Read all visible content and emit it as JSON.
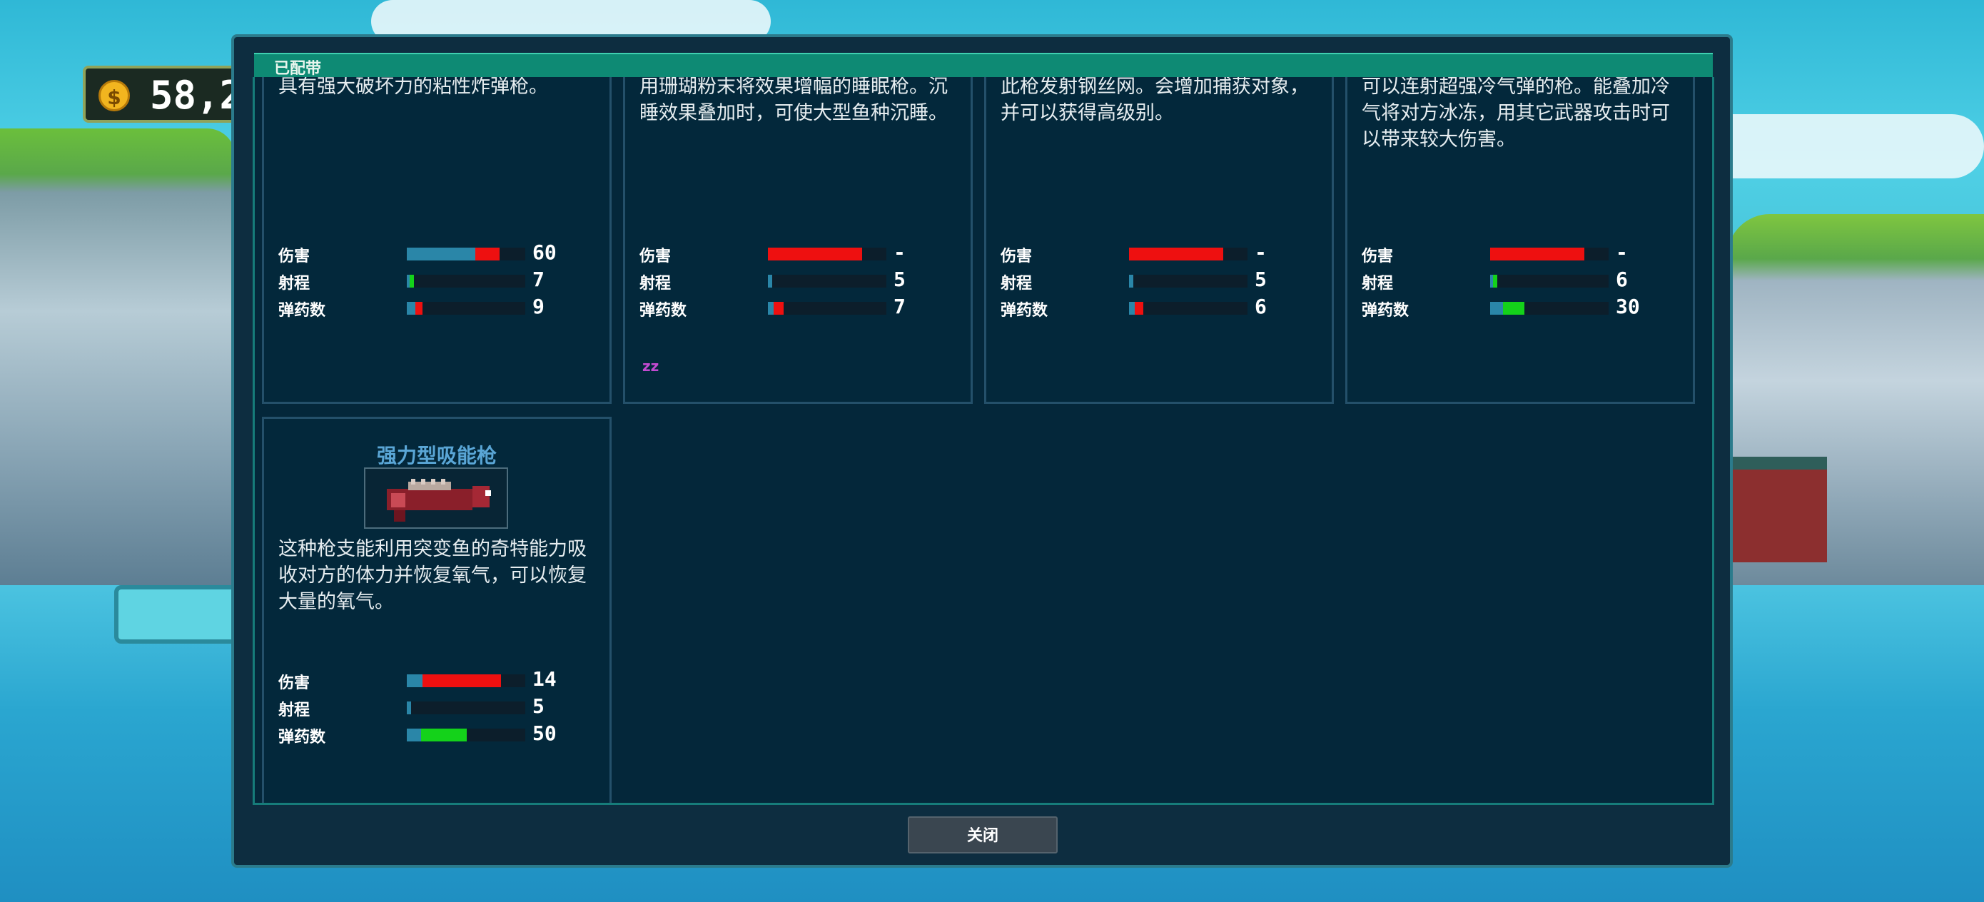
{
  "hud": {
    "coins": "58,2"
  },
  "dialog": {
    "title": "已配带",
    "close_label": "关闭",
    "weapons": [
      {
        "desc": "具有强大破坏力的粘性炸弹枪。",
        "stats": [
          {
            "label": "伤害",
            "value": "60",
            "level": 0.45,
            "color": "#ee1010"
          },
          {
            "label": "射程",
            "value": "7",
            "level": 0.04,
            "color": "#14d21a"
          },
          {
            "label": "弹药数",
            "value": "9",
            "level": 0.04,
            "color": "#ee1010"
          }
        ]
      },
      {
        "desc": "用珊瑚粉末将效果增幅的睡眠枪。沉睡效果叠加时，可使大型鱼种沉睡。",
        "stats": [
          {
            "label": "伤害",
            "value": "-",
            "level": 0.8,
            "color": "#ee1010"
          },
          {
            "label": "射程",
            "value": "5",
            "level": 0.03,
            "color": "#2a86a8"
          },
          {
            "label": "弹药数",
            "value": "7",
            "level": 0.07,
            "color": "#ee1010"
          }
        ],
        "effect_icon": "zz"
      },
      {
        "desc": "此枪发射钢丝网。会增加捕获对象，并可以获得高级别。",
        "stats": [
          {
            "label": "伤害",
            "value": "-",
            "level": 0.8,
            "color": "#ee1010"
          },
          {
            "label": "射程",
            "value": "5",
            "level": 0.03,
            "color": "#2a86a8"
          },
          {
            "label": "弹药数",
            "value": "6",
            "level": 0.07,
            "color": "#ee1010"
          }
        ]
      },
      {
        "desc": "可以连射超强冷气弹的枪。能叠加冷气将对方冰冻，用其它武器攻击时可以带来较大伤害。",
        "stats": [
          {
            "label": "伤害",
            "value": "-",
            "level": 0.8,
            "color": "#ee1010"
          },
          {
            "label": "射程",
            "value": "6",
            "level": 0.04,
            "color": "#14d21a"
          },
          {
            "label": "弹药数",
            "value": "30",
            "level": 0.2,
            "color": "#14d21a"
          }
        ]
      },
      {
        "name": "强力型吸能枪",
        "desc": "这种枪支能利用突变鱼的奇特能力吸收对方的体力并恢复氧气，可以恢复大量的氧气。",
        "stats": [
          {
            "label": "伤害",
            "value": "14",
            "level": 0.7,
            "color": "#ee1010"
          },
          {
            "label": "射程",
            "value": "5",
            "level": 0.03,
            "color": "#2a86a8"
          },
          {
            "label": "弹药数",
            "value": "50",
            "level": 0.42,
            "color": "#14d21a"
          }
        ]
      }
    ]
  }
}
